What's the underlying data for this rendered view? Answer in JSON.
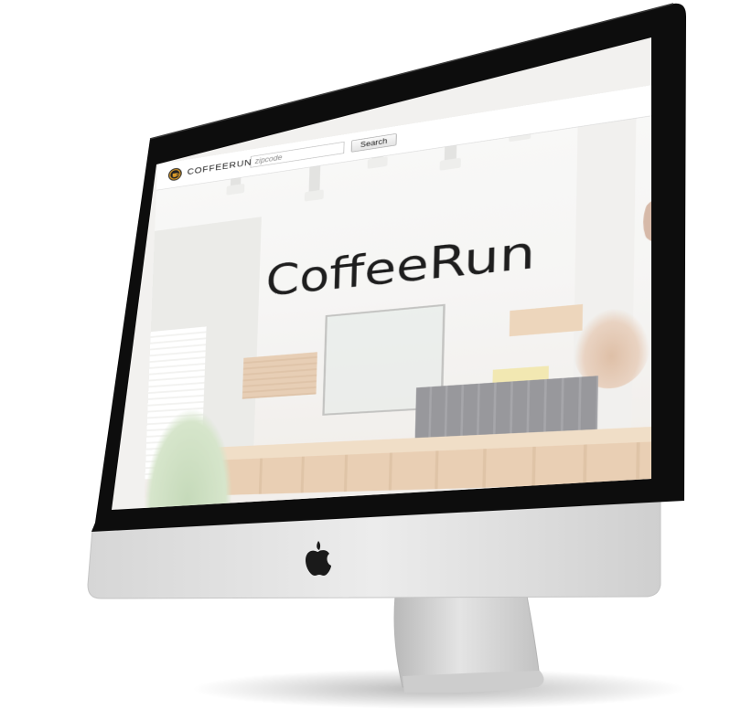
{
  "device": {
    "type": "iMac",
    "logo_icon": "apple-logo-icon"
  },
  "site": {
    "navbar": {
      "logo_icon": "coffee-cup-icon",
      "brand": "COFFEERUN",
      "search": {
        "placeholder": "zipcode",
        "value": ""
      },
      "search_button_label": "Search"
    },
    "hero": {
      "title": "CoffeeRun",
      "background": "coffee-shop-interior-photo"
    }
  },
  "colors": {
    "bezel": "#0d0d0d",
    "chin": "#e3e3e3",
    "navbar_bg": "#ffffff",
    "title": "#1e1e1e",
    "logo_ring": "#d99a2a"
  }
}
